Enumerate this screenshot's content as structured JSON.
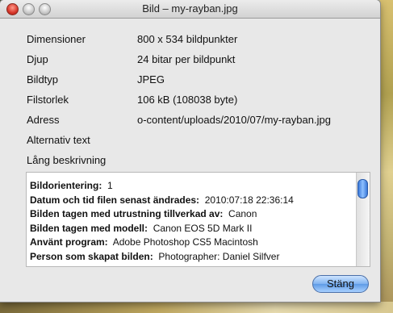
{
  "window": {
    "title": "Bild – my-rayban.jpg"
  },
  "properties": [
    {
      "label": "Dimensioner",
      "value": "800 x 534 bildpunkter"
    },
    {
      "label": "Djup",
      "value": "24 bitar per bildpunkt"
    },
    {
      "label": "Bildtyp",
      "value": "JPEG"
    },
    {
      "label": "Filstorlek",
      "value": "106 kB (108038 byte)"
    },
    {
      "label": "Adress",
      "value": "o-content/uploads/2010/07/my-rayban.jpg"
    },
    {
      "label": "Alternativ text",
      "value": ""
    },
    {
      "label": "Lång beskrivning",
      "value": ""
    }
  ],
  "details": [
    {
      "key": "Bildorientering:",
      "value": "1"
    },
    {
      "key": "Datum och tid filen senast ändrades:",
      "value": "2010:07:18 22:36:14"
    },
    {
      "key": "Bilden tagen med utrustning tillverkad av:",
      "value": "Canon"
    },
    {
      "key": "Bilden tagen med modell:",
      "value": "Canon EOS 5D Mark II"
    },
    {
      "key": "Använt program:",
      "value": "Adobe Photoshop CS5 Macintosh"
    },
    {
      "key": "Person som skapat bilden:",
      "value": "Photographer: Daniel Silfver"
    }
  ],
  "buttons": {
    "close_label": "Stäng"
  }
}
